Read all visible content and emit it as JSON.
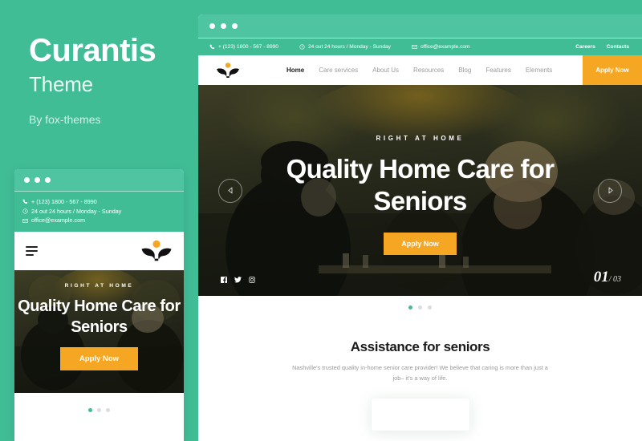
{
  "brand": {
    "title": "Curantis",
    "subtitle": "Theme",
    "author": "By fox-themes"
  },
  "colors": {
    "green": "#41bd96",
    "green_light": "#4ec5a0",
    "orange": "#f5a623",
    "dark_text": "#1b1b1b",
    "muted_text": "#9a9a9a"
  },
  "contact": {
    "phone": "+ (123) 1800 - 567 - 8990",
    "hours": "24 out 24 hours / Monday - Sunday",
    "email": "office@example.com",
    "phone_icon": "phone-icon",
    "clock_icon": "clock-icon",
    "mail_icon": "envelope-icon"
  },
  "topbar_links": [
    {
      "label": "Careers"
    },
    {
      "label": "Contacts"
    }
  ],
  "nav": {
    "logo_icon": "curantis-logo-icon",
    "menu_icon": "hamburger-menu-icon",
    "items": [
      {
        "label": "Home",
        "active": true
      },
      {
        "label": "Care services",
        "active": false
      },
      {
        "label": "About Us",
        "active": false
      },
      {
        "label": "Resources",
        "active": false
      },
      {
        "label": "Blog",
        "active": false
      },
      {
        "label": "Features",
        "active": false
      },
      {
        "label": "Elements",
        "active": false
      }
    ],
    "cta_label": "Apply Now"
  },
  "hero": {
    "eyebrow": "RIGHT AT HOME",
    "headline": "Quality Home Care for Seniors",
    "cta_label": "Apply Now",
    "prev_icon": "chevron-left-icon",
    "next_icon": "chevron-right-icon",
    "socials": [
      {
        "name": "facebook-icon"
      },
      {
        "name": "twitter-icon"
      },
      {
        "name": "instagram-icon"
      }
    ],
    "counter_current": "01",
    "counter_total": "/ 03",
    "slides": [
      {
        "active": true
      },
      {
        "active": false
      },
      {
        "active": false
      }
    ]
  },
  "assistance": {
    "title": "Assistance for seniors",
    "description": "Nashville's trusted quality in-home senior care provider! We believe that caring is more than just a job– it's a way of life."
  },
  "window_dots": [
    {
      "name": "window-dot"
    },
    {
      "name": "window-dot"
    },
    {
      "name": "window-dot"
    }
  ]
}
